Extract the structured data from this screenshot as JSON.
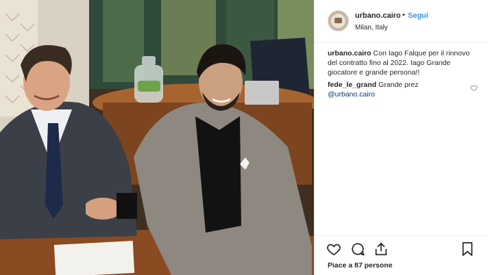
{
  "post": {
    "username": "urbano.cairo",
    "bullet": "•",
    "follow_label": "Segui",
    "location": "Milan, Italy",
    "caption_user": "urbano.cairo",
    "caption_text": " Con Iago Falque per il rinnovo del contratto fino al 2022. Iago Grande giocatore e grande persona!!",
    "comment_user": "fede_le_grand",
    "comment_text": " Grande prez",
    "comment_mention": "@urbano.cairo",
    "likes_text": "Piace a 87 persone"
  },
  "icons": {
    "avatar": "avatar-image",
    "like": "heart-icon",
    "comment": "comment-bubble-icon",
    "share": "share-icon",
    "save": "bookmark-icon",
    "comment_like": "heart-small-icon"
  },
  "colors": {
    "link_blue": "#3897f0",
    "mention_blue": "#003569",
    "text": "#262626",
    "divider": "#efefef"
  }
}
